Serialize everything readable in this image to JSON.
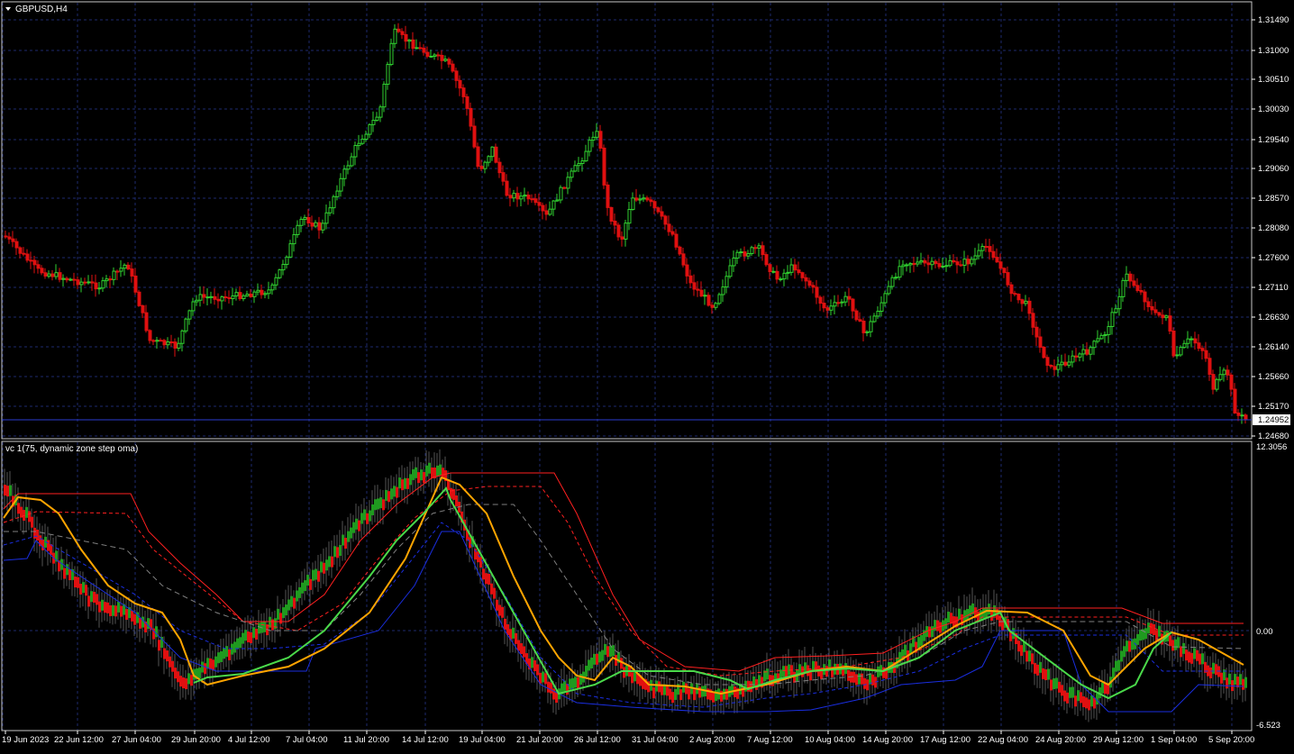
{
  "window": {
    "symbol_label": "GBPUSD,H4",
    "menu_arrow_icon": "triangle-down-icon"
  },
  "price_panel": {
    "price_labels": [
      "1.31490",
      "1.31000",
      "1.30510",
      "1.30030",
      "1.29540",
      "1.29060",
      "1.28570",
      "1.28080",
      "1.27600",
      "1.27110",
      "1.26630",
      "1.26140",
      "1.25660",
      "1.25170",
      "1.24680"
    ],
    "current_price": "1.24952"
  },
  "indicator_panel": {
    "title": "vc 1(75, dynamic zone step oma)",
    "max_label": "12.3056",
    "zero_label": "0.00",
    "min_label": "-6.523"
  },
  "time_axis": {
    "labels": [
      "19 Jun 2023",
      "22 Jun 12:00",
      "27 Jun 04:00",
      "29 Jun 20:00",
      "4 Jul 12:00",
      "7 Jul 04:00",
      "11 Jul 20:00",
      "14 Jul 12:00",
      "19 Jul 04:00",
      "21 Jul 20:00",
      "26 Jul 12:00",
      "31 Jul 04:00",
      "2 Aug 20:00",
      "7 Aug 12:00",
      "10 Aug 04:00",
      "14 Aug 20:00",
      "17 Aug 12:00",
      "22 Aug 04:00",
      "24 Aug 20:00",
      "29 Aug 12:00",
      "1 Sep 04:00",
      "5 Sep 20:00"
    ]
  },
  "colors": {
    "background": "#000000",
    "grid": "#1e2a6e",
    "bull_candle": "#2fd12f",
    "bear_candle": "#e01010",
    "axis_text": "#ffffff",
    "signal_up": "#4ad94a",
    "signal_down": "#ffa500",
    "zone_upper": "#ff2020",
    "zone_lower": "#1a2ee0",
    "zone_mid": "#808080"
  }
}
